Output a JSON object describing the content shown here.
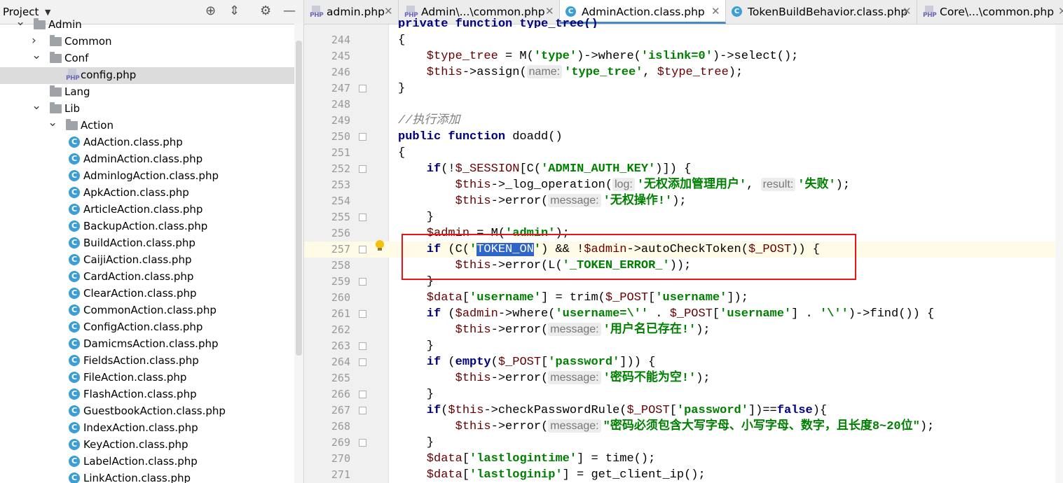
{
  "project": {
    "title": "Project",
    "tree": [
      {
        "label": "Admin",
        "type": "folder",
        "depth": 0,
        "expanded": true
      },
      {
        "label": "Common",
        "type": "folder",
        "depth": 1,
        "expanded": false
      },
      {
        "label": "Conf",
        "type": "folder",
        "depth": 1,
        "expanded": true
      },
      {
        "label": "config.php",
        "type": "php",
        "depth": 2,
        "selected": true
      },
      {
        "label": "Lang",
        "type": "folder",
        "depth": 1,
        "expanded": false,
        "leaf": true
      },
      {
        "label": "Lib",
        "type": "folder",
        "depth": 1,
        "expanded": true
      },
      {
        "label": "Action",
        "type": "folder",
        "depth": 2,
        "expanded": true
      },
      {
        "label": "AdAction.class.php",
        "type": "class",
        "depth": 3
      },
      {
        "label": "AdminAction.class.php",
        "type": "class",
        "depth": 3
      },
      {
        "label": "AdminlogAction.class.php",
        "type": "class",
        "depth": 3
      },
      {
        "label": "ApkAction.class.php",
        "type": "class",
        "depth": 3
      },
      {
        "label": "ArticleAction.class.php",
        "type": "class",
        "depth": 3
      },
      {
        "label": "BackupAction.class.php",
        "type": "class",
        "depth": 3
      },
      {
        "label": "BuildAction.class.php",
        "type": "class",
        "depth": 3
      },
      {
        "label": "CaijiAction.class.php",
        "type": "class",
        "depth": 3
      },
      {
        "label": "CardAction.class.php",
        "type": "class",
        "depth": 3
      },
      {
        "label": "ClearAction.class.php",
        "type": "class",
        "depth": 3
      },
      {
        "label": "CommonAction.class.php",
        "type": "class",
        "depth": 3
      },
      {
        "label": "ConfigAction.class.php",
        "type": "class",
        "depth": 3
      },
      {
        "label": "DamicmsAction.class.php",
        "type": "class",
        "depth": 3
      },
      {
        "label": "FieldsAction.class.php",
        "type": "class",
        "depth": 3
      },
      {
        "label": "FileAction.class.php",
        "type": "class",
        "depth": 3
      },
      {
        "label": "FlashAction.class.php",
        "type": "class",
        "depth": 3
      },
      {
        "label": "GuestbookAction.class.php",
        "type": "class",
        "depth": 3
      },
      {
        "label": "IndexAction.class.php",
        "type": "class",
        "depth": 3
      },
      {
        "label": "KeyAction.class.php",
        "type": "class",
        "depth": 3
      },
      {
        "label": "LabelAction.class.php",
        "type": "class",
        "depth": 3
      },
      {
        "label": "LinkAction.class.php",
        "type": "class",
        "depth": 3
      }
    ]
  },
  "tabs": [
    {
      "label": "admin.php",
      "icon": "php-file-icon",
      "active": false
    },
    {
      "label": "Admin\\...\\common.php",
      "icon": "php-file-icon",
      "active": false
    },
    {
      "label": "AdminAction.class.php",
      "icon": "class-file-icon",
      "active": true
    },
    {
      "label": "TokenBuildBehavior.class.php",
      "icon": "class-file-icon",
      "active": false
    },
    {
      "label": "Core\\...\\common.php",
      "icon": "php-file-icon",
      "active": false
    }
  ],
  "line_numbers": [
    "244",
    "245",
    "246",
    "247",
    "248",
    "249",
    "250",
    "251",
    "252",
    "253",
    "254",
    "255",
    "256",
    "257",
    "258",
    "259",
    "260",
    "261",
    "262",
    "263",
    "264",
    "265",
    "266",
    "267",
    "268",
    "269",
    "270",
    "271"
  ],
  "top_partial_line": "private function type_tree()",
  "caret_line": "257",
  "code": [
    [
      {
        "t": "{",
        "c": ""
      }
    ],
    [
      {
        "t": "    $type_tree",
        "c": "var"
      },
      {
        "t": " = M(",
        "c": ""
      },
      {
        "t": "'type'",
        "c": "str"
      },
      {
        "t": ")->where(",
        "c": ""
      },
      {
        "t": "'islink=0'",
        "c": "str"
      },
      {
        "t": ")->select();",
        "c": ""
      }
    ],
    [
      {
        "t": "    $this",
        "c": "var"
      },
      {
        "t": "->assign(",
        "c": ""
      },
      {
        "h": "name:"
      },
      {
        "t": "'type_tree'",
        "c": "str"
      },
      {
        "t": ", ",
        "c": ""
      },
      {
        "t": "$type_tree",
        "c": "var"
      },
      {
        "t": ");",
        "c": ""
      }
    ],
    [
      {
        "t": "}",
        "c": ""
      }
    ],
    [
      {
        "t": "",
        "c": ""
      }
    ],
    [
      {
        "t": "//执行添加",
        "c": "cmt"
      }
    ],
    [
      {
        "t": "public function ",
        "c": "kw"
      },
      {
        "t": "doadd()",
        "c": ""
      }
    ],
    [
      {
        "t": "{",
        "c": ""
      }
    ],
    [
      {
        "t": "    if",
        "c": "kw"
      },
      {
        "t": "(!",
        "c": ""
      },
      {
        "t": "$_SESSION",
        "c": "var"
      },
      {
        "t": "[C(",
        "c": ""
      },
      {
        "t": "'ADMIN_AUTH_KEY'",
        "c": "str"
      },
      {
        "t": ")]) {",
        "c": ""
      }
    ],
    [
      {
        "t": "        $this",
        "c": "var"
      },
      {
        "t": "->_log_operation(",
        "c": ""
      },
      {
        "h": "log:"
      },
      {
        "t": "'无权添加管理用户'",
        "c": "str"
      },
      {
        "t": ", ",
        "c": ""
      },
      {
        "h": "result:"
      },
      {
        "t": "'失败'",
        "c": "str"
      },
      {
        "t": ");",
        "c": ""
      }
    ],
    [
      {
        "t": "        $this",
        "c": "var"
      },
      {
        "t": "->error(",
        "c": ""
      },
      {
        "h": "message:"
      },
      {
        "t": "'无权操作!'",
        "c": "str"
      },
      {
        "t": ");",
        "c": ""
      }
    ],
    [
      {
        "t": "    }",
        "c": ""
      }
    ],
    [
      {
        "t": "    $admin",
        "c": "var"
      },
      {
        "t": " = M(",
        "c": ""
      },
      {
        "t": "'admin'",
        "c": "str"
      },
      {
        "t": ");",
        "c": ""
      }
    ],
    [
      {
        "t": "    if",
        "c": "kw"
      },
      {
        "t": " (C(",
        "c": ""
      },
      {
        "t": "'",
        "c": "str"
      },
      {
        "t": "TOKEN_ON",
        "c": "sel"
      },
      {
        "t": "'",
        "c": "str"
      },
      {
        "t": ") && !",
        "c": ""
      },
      {
        "t": "$admin",
        "c": "var"
      },
      {
        "t": "->autoCheckToken(",
        "c": ""
      },
      {
        "t": "$_POST",
        "c": "var"
      },
      {
        "t": ")) {",
        "c": ""
      }
    ],
    [
      {
        "t": "        $this",
        "c": "var"
      },
      {
        "t": "->error(L(",
        "c": ""
      },
      {
        "t": "'_TOKEN_ERROR_'",
        "c": "str"
      },
      {
        "t": "));",
        "c": ""
      }
    ],
    [
      {
        "t": "    }",
        "c": ""
      }
    ],
    [
      {
        "t": "    $data",
        "c": "var"
      },
      {
        "t": "[",
        "c": ""
      },
      {
        "t": "'username'",
        "c": "str"
      },
      {
        "t": "] = trim(",
        "c": ""
      },
      {
        "t": "$_POST",
        "c": "var"
      },
      {
        "t": "[",
        "c": ""
      },
      {
        "t": "'username'",
        "c": "str"
      },
      {
        "t": "]);",
        "c": ""
      }
    ],
    [
      {
        "t": "    if",
        "c": "kw"
      },
      {
        "t": " (",
        "c": ""
      },
      {
        "t": "$admin",
        "c": "var"
      },
      {
        "t": "->where(",
        "c": ""
      },
      {
        "t": "'username=\\''",
        "c": "str"
      },
      {
        "t": " . ",
        "c": ""
      },
      {
        "t": "$_POST",
        "c": "var"
      },
      {
        "t": "[",
        "c": ""
      },
      {
        "t": "'username'",
        "c": "str"
      },
      {
        "t": "] . ",
        "c": ""
      },
      {
        "t": "'\\''",
        "c": "str"
      },
      {
        "t": ")->find()) {",
        "c": ""
      }
    ],
    [
      {
        "t": "        $this",
        "c": "var"
      },
      {
        "t": "->error(",
        "c": ""
      },
      {
        "h": "message:"
      },
      {
        "t": "'用户名已存在!'",
        "c": "str"
      },
      {
        "t": ");",
        "c": ""
      }
    ],
    [
      {
        "t": "    }",
        "c": ""
      }
    ],
    [
      {
        "t": "    if",
        "c": "kw"
      },
      {
        "t": " (",
        "c": ""
      },
      {
        "t": "empty",
        "c": "kw"
      },
      {
        "t": "(",
        "c": ""
      },
      {
        "t": "$_POST",
        "c": "var"
      },
      {
        "t": "[",
        "c": ""
      },
      {
        "t": "'password'",
        "c": "str"
      },
      {
        "t": "])) {",
        "c": ""
      }
    ],
    [
      {
        "t": "        $this",
        "c": "var"
      },
      {
        "t": "->error(",
        "c": ""
      },
      {
        "h": "message:"
      },
      {
        "t": "'密码不能为空!'",
        "c": "str"
      },
      {
        "t": ");",
        "c": ""
      }
    ],
    [
      {
        "t": "    }",
        "c": ""
      }
    ],
    [
      {
        "t": "    if",
        "c": "kw"
      },
      {
        "t": "(",
        "c": ""
      },
      {
        "t": "$this",
        "c": "var"
      },
      {
        "t": "->checkPasswordRule(",
        "c": ""
      },
      {
        "t": "$_POST",
        "c": "var"
      },
      {
        "t": "[",
        "c": ""
      },
      {
        "t": "'password'",
        "c": "str"
      },
      {
        "t": "])==",
        "c": ""
      },
      {
        "t": "false",
        "c": "kw"
      },
      {
        "t": "){",
        "c": ""
      }
    ],
    [
      {
        "t": "        $this",
        "c": "var"
      },
      {
        "t": "->error(",
        "c": ""
      },
      {
        "h": "message:"
      },
      {
        "t": "\"密码必须包含大写字母、小写字母、数字，且长度8~20位\"",
        "c": "str"
      },
      {
        "t": ");",
        "c": ""
      }
    ],
    [
      {
        "t": "    }",
        "c": ""
      }
    ],
    [
      {
        "t": "    $data",
        "c": "var"
      },
      {
        "t": "[",
        "c": ""
      },
      {
        "t": "'lastlogintime'",
        "c": "str"
      },
      {
        "t": "] = time();",
        "c": ""
      }
    ],
    [
      {
        "t": "    $data",
        "c": "var"
      },
      {
        "t": "[",
        "c": ""
      },
      {
        "t": "'lastloginip'",
        "c": "str"
      },
      {
        "t": "] = get_client_ip();",
        "c": ""
      }
    ]
  ],
  "colors": {
    "accent": "#4a88c7",
    "highlight_box": "#e8141a",
    "selection": "#2f65ca",
    "string": "#008000",
    "keyword": "#000080"
  }
}
